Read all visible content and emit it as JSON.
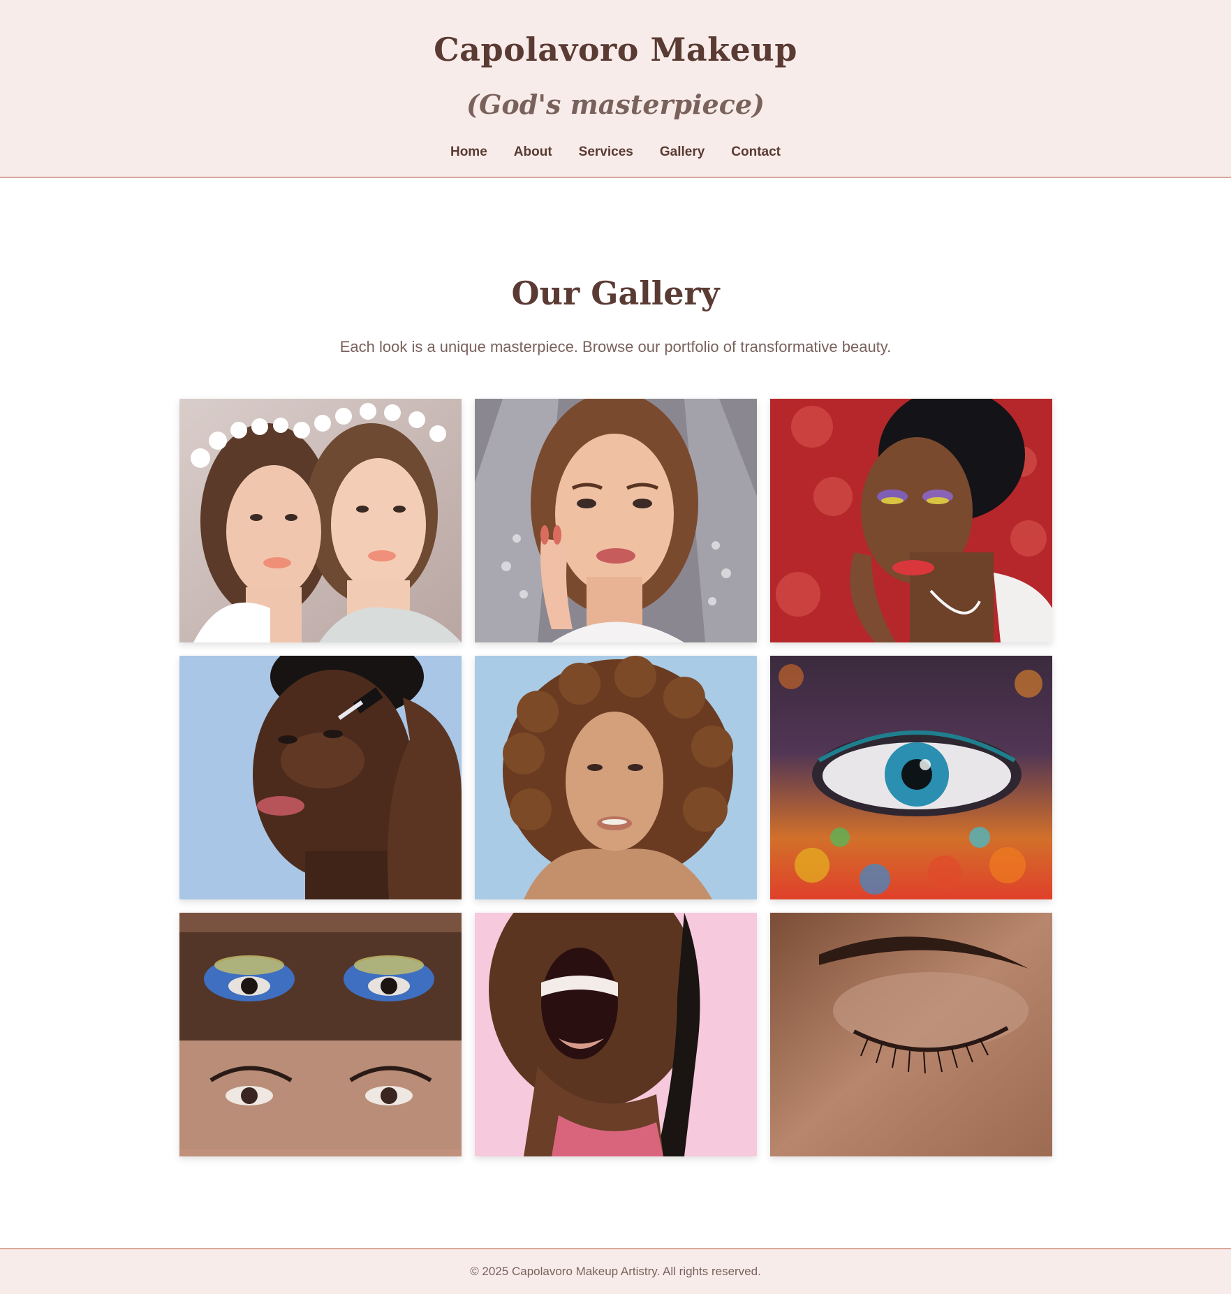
{
  "header": {
    "title": "Capolavoro Makeup",
    "tagline": "(God's masterpiece)",
    "nav": [
      {
        "label": "Home"
      },
      {
        "label": "About"
      },
      {
        "label": "Services"
      },
      {
        "label": "Gallery"
      },
      {
        "label": "Contact"
      }
    ]
  },
  "gallery": {
    "title": "Our Gallery",
    "intro": "Each look is a unique masterpiece. Browse our portfolio of transformative beauty.",
    "images": [
      {
        "name": "two-brides-flower-crowns-photo"
      },
      {
        "name": "bride-veil-portrait-photo"
      },
      {
        "name": "glitter-eyeshadow-portrait-photo"
      },
      {
        "name": "serum-dropper-skincare-photo"
      },
      {
        "name": "curly-hair-portrait-photo"
      },
      {
        "name": "colorful-powder-eye-photo"
      },
      {
        "name": "blue-eyeshadow-eyes-strip-photo"
      },
      {
        "name": "laughing-woman-pink-background-photo"
      },
      {
        "name": "closed-eye-closeup-photo"
      }
    ]
  },
  "footer": {
    "text": "© 2025 Capolavoro Makeup Artistry. All rights reserved."
  }
}
